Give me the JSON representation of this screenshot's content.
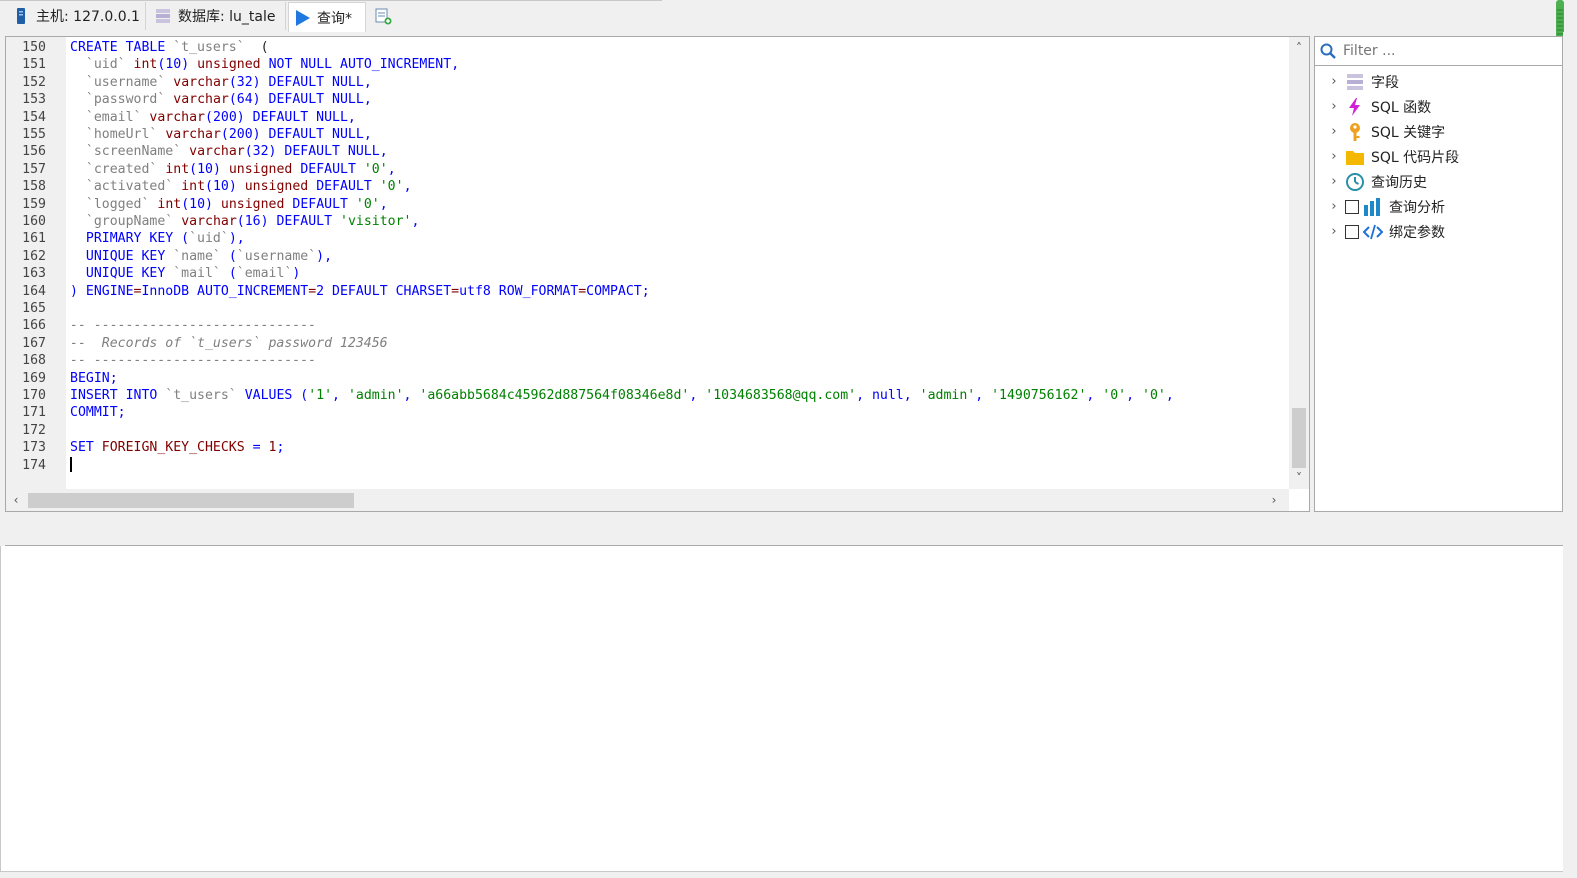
{
  "tabs": [
    {
      "label": "主机: 127.0.0.1",
      "icon": "server-icon"
    },
    {
      "label": "数据库: lu_tale",
      "icon": "database-icon"
    },
    {
      "label": "查询*",
      "icon": "play-icon"
    },
    {
      "label": "",
      "icon": "new-query-icon"
    }
  ],
  "editor": {
    "lines": [
      {
        "n": "150",
        "tokens": [
          [
            "kw",
            "CREATE TABLE "
          ],
          [
            "id",
            "`t_users`"
          ],
          [
            "",
            "  ("
          ]
        ]
      },
      {
        "n": "151",
        "tokens": [
          [
            "",
            "  "
          ],
          [
            "id",
            "`uid`"
          ],
          [
            "",
            " "
          ],
          [
            "ty",
            "int"
          ],
          [
            "kw",
            "(10)"
          ],
          [
            "",
            " "
          ],
          [
            "ty",
            "unsigned"
          ],
          [
            "",
            " "
          ],
          [
            "kw",
            "NOT NULL AUTO_INCREMENT"
          ],
          [
            "kw",
            ","
          ]
        ]
      },
      {
        "n": "152",
        "tokens": [
          [
            "",
            "  "
          ],
          [
            "id",
            "`username`"
          ],
          [
            "",
            " "
          ],
          [
            "ty",
            "varchar"
          ],
          [
            "kw",
            "(32)"
          ],
          [
            "kw",
            " DEFAULT NULL"
          ],
          [
            "kw",
            ","
          ]
        ]
      },
      {
        "n": "153",
        "tokens": [
          [
            "",
            "  "
          ],
          [
            "id",
            "`password`"
          ],
          [
            "",
            " "
          ],
          [
            "ty",
            "varchar"
          ],
          [
            "kw",
            "(64)"
          ],
          [
            "kw",
            " DEFAULT NULL"
          ],
          [
            "kw",
            ","
          ]
        ]
      },
      {
        "n": "154",
        "tokens": [
          [
            "",
            "  "
          ],
          [
            "id",
            "`email`"
          ],
          [
            "",
            " "
          ],
          [
            "ty",
            "varchar"
          ],
          [
            "kw",
            "(200)"
          ],
          [
            "kw",
            " DEFAULT NULL"
          ],
          [
            "kw",
            ","
          ]
        ]
      },
      {
        "n": "155",
        "tokens": [
          [
            "",
            "  "
          ],
          [
            "id",
            "`homeUrl`"
          ],
          [
            "",
            " "
          ],
          [
            "ty",
            "varchar"
          ],
          [
            "kw",
            "(200)"
          ],
          [
            "kw",
            " DEFAULT NULL"
          ],
          [
            "kw",
            ","
          ]
        ]
      },
      {
        "n": "156",
        "tokens": [
          [
            "",
            "  "
          ],
          [
            "id",
            "`screenName`"
          ],
          [
            "",
            " "
          ],
          [
            "ty",
            "varchar"
          ],
          [
            "kw",
            "(32)"
          ],
          [
            "kw",
            " DEFAULT NULL"
          ],
          [
            "kw",
            ","
          ]
        ]
      },
      {
        "n": "157",
        "tokens": [
          [
            "",
            "  "
          ],
          [
            "id",
            "`created`"
          ],
          [
            "",
            " "
          ],
          [
            "ty",
            "int"
          ],
          [
            "kw",
            "(10)"
          ],
          [
            "",
            " "
          ],
          [
            "ty",
            "unsigned"
          ],
          [
            "kw",
            " DEFAULT "
          ],
          [
            "st",
            "'0'"
          ],
          [
            "kw",
            ","
          ]
        ]
      },
      {
        "n": "158",
        "tokens": [
          [
            "",
            "  "
          ],
          [
            "id",
            "`activated`"
          ],
          [
            "",
            " "
          ],
          [
            "ty",
            "int"
          ],
          [
            "kw",
            "(10)"
          ],
          [
            "",
            " "
          ],
          [
            "ty",
            "unsigned"
          ],
          [
            "kw",
            " DEFAULT "
          ],
          [
            "st",
            "'0'"
          ],
          [
            "kw",
            ","
          ]
        ]
      },
      {
        "n": "159",
        "tokens": [
          [
            "",
            "  "
          ],
          [
            "id",
            "`logged`"
          ],
          [
            "",
            " "
          ],
          [
            "ty",
            "int"
          ],
          [
            "kw",
            "(10)"
          ],
          [
            "",
            " "
          ],
          [
            "ty",
            "unsigned"
          ],
          [
            "kw",
            " DEFAULT "
          ],
          [
            "st",
            "'0'"
          ],
          [
            "kw",
            ","
          ]
        ]
      },
      {
        "n": "160",
        "tokens": [
          [
            "",
            "  "
          ],
          [
            "id",
            "`groupName`"
          ],
          [
            "",
            " "
          ],
          [
            "ty",
            "varchar"
          ],
          [
            "kw",
            "(16)"
          ],
          [
            "kw",
            " DEFAULT "
          ],
          [
            "st",
            "'visitor'"
          ],
          [
            "kw",
            ","
          ]
        ]
      },
      {
        "n": "161",
        "tokens": [
          [
            "",
            "  "
          ],
          [
            "kw",
            "PRIMARY KEY ("
          ],
          [
            "id",
            "`uid`"
          ],
          [
            "kw",
            "),"
          ]
        ]
      },
      {
        "n": "162",
        "tokens": [
          [
            "",
            "  "
          ],
          [
            "kw",
            "UNIQUE KEY "
          ],
          [
            "id",
            "`name`"
          ],
          [
            "kw",
            " ("
          ],
          [
            "id",
            "`username`"
          ],
          [
            "kw",
            "),"
          ]
        ]
      },
      {
        "n": "163",
        "tokens": [
          [
            "",
            "  "
          ],
          [
            "kw",
            "UNIQUE KEY "
          ],
          [
            "id",
            "`mail`"
          ],
          [
            "kw",
            " ("
          ],
          [
            "id",
            "`email`"
          ],
          [
            "kw",
            ")"
          ]
        ]
      },
      {
        "n": "164",
        "tokens": [
          [
            "kw",
            ") ENGINE"
          ],
          [
            "ty",
            "="
          ],
          [
            "kw",
            "InnoDB AUTO_INCREMENT"
          ],
          [
            "ty",
            "="
          ],
          [
            "kw",
            "2 DEFAULT CHARSET"
          ],
          [
            "ty",
            "="
          ],
          [
            "kw",
            "utf8 ROW_FORMAT"
          ],
          [
            "ty",
            "="
          ],
          [
            "kw",
            "COMPACT;"
          ]
        ]
      },
      {
        "n": "165",
        "tokens": []
      },
      {
        "n": "166",
        "tokens": [
          [
            "cm",
            "-- ----------------------------"
          ]
        ]
      },
      {
        "n": "167",
        "tokens": [
          [
            "cm",
            "--  Records of `t_users` password 123456"
          ]
        ]
      },
      {
        "n": "168",
        "tokens": [
          [
            "cm",
            "-- ----------------------------"
          ]
        ]
      },
      {
        "n": "169",
        "tokens": [
          [
            "kw",
            "BEGIN;"
          ]
        ]
      },
      {
        "n": "170",
        "tokens": [
          [
            "kw",
            "INSERT INTO "
          ],
          [
            "id",
            "`t_users`"
          ],
          [
            "kw",
            " VALUES ("
          ],
          [
            "st",
            "'1'"
          ],
          [
            "kw",
            ", "
          ],
          [
            "st",
            "'admin'"
          ],
          [
            "kw",
            ", "
          ],
          [
            "st",
            "'a66abb5684c45962d887564f08346e8d'"
          ],
          [
            "kw",
            ", "
          ],
          [
            "st",
            "'1034683568@qq.com'"
          ],
          [
            "kw",
            ", null, "
          ],
          [
            "st",
            "'admin'"
          ],
          [
            "kw",
            ", "
          ],
          [
            "st",
            "'1490756162'"
          ],
          [
            "kw",
            ", "
          ],
          [
            "st",
            "'0'"
          ],
          [
            "kw",
            ", "
          ],
          [
            "st",
            "'0'"
          ],
          [
            "kw",
            ","
          ]
        ]
      },
      {
        "n": "171",
        "tokens": [
          [
            "kw",
            "COMMIT;"
          ]
        ]
      },
      {
        "n": "172",
        "tokens": []
      },
      {
        "n": "173",
        "tokens": [
          [
            "kw",
            "SET "
          ],
          [
            "ty",
            "FOREIGN_KEY_CHECKS"
          ],
          [
            "kw",
            " = "
          ],
          [
            "ty",
            "1"
          ],
          [
            "kw",
            ";"
          ]
        ]
      },
      {
        "n": "174",
        "tokens": [],
        "cursor": true
      }
    ]
  },
  "sidebar": {
    "filter_placeholder": "Filter ...",
    "items": [
      {
        "label": "字段",
        "icon": "fields-icon",
        "checkbox": false
      },
      {
        "label": "SQL 函数",
        "icon": "lightning-icon",
        "checkbox": false
      },
      {
        "label": "SQL 关键字",
        "icon": "key-icon",
        "checkbox": false
      },
      {
        "label": "SQL 代码片段",
        "icon": "folder-icon",
        "checkbox": false
      },
      {
        "label": "查询历史",
        "icon": "clock-icon",
        "checkbox": false
      },
      {
        "label": "查询分析",
        "icon": "bar-chart-icon",
        "checkbox": true
      },
      {
        "label": "绑定参数",
        "icon": "code-icon",
        "checkbox": true
      }
    ]
  },
  "colors": {
    "keyword": "#0000ff",
    "type": "#800000",
    "identifier": "#808080",
    "string": "#008000",
    "comment": "#808080"
  }
}
